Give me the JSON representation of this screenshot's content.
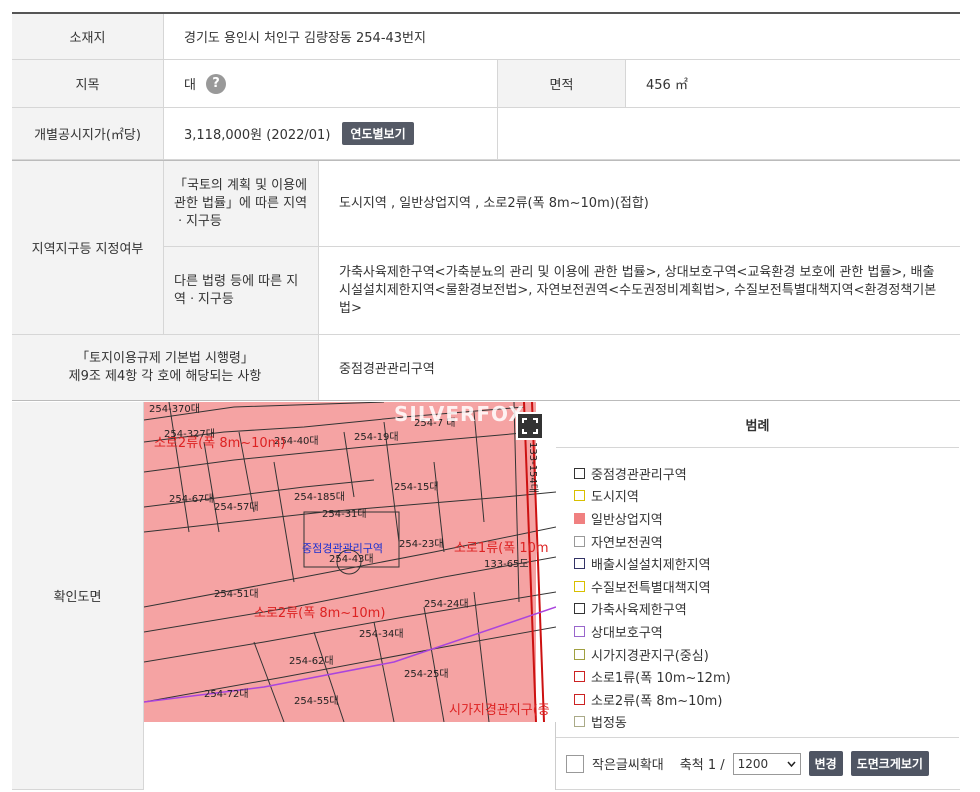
{
  "info": {
    "location_label": "소재지",
    "location_value": "경기도 용인시 처인구 김량장동 254-43번지",
    "category_label": "지목",
    "category_value": "대",
    "help_icon": "?",
    "area_label": "면적",
    "area_value": "456 ㎡",
    "price_label": "개별공시지가(㎡당)",
    "price_value": "3,118,000원 (2022/01)",
    "yearly_button": "연도별보기"
  },
  "zoning": {
    "label": "지역지구등 지정여부",
    "national_label": "「국토의 계획 및 이용에 관한 법률」에 따른 지역ㆍ지구등",
    "national_value": "도시지역 , 일반상업지역 , 소로2류(폭 8m~10m)(접합)",
    "other_label": "다른 법령 등에 따른 지역ㆍ지구등",
    "other_value": "가축사육제한구역<가축분뇨의 관리 및 이용에 관한 법률>, 상대보호구역<교육환경 보호에 관한 법률>, 배출시설설치제한지역<물환경보전법>, 자연보전권역<수도권정비계획법>, 수질보전특별대책지역<환경정책기본법>"
  },
  "rule": {
    "label_line1": "「토지이용규제 기본법 시행령」",
    "label_line2": "제9조 제4항 각 호에 해당되는 사항",
    "value": "중점경관관리구역"
  },
  "map": {
    "label": "확인도면",
    "watermark": "SILVERFOX",
    "parcels": [
      {
        "text": "254-370대"
      },
      {
        "text": "254-327대"
      },
      {
        "text": "254-40대"
      },
      {
        "text": "254-19대"
      },
      {
        "text": "254-7 대"
      },
      {
        "text": "254-185대"
      },
      {
        "text": "254-15대"
      },
      {
        "text": "254-67대"
      },
      {
        "text": "254-57대"
      },
      {
        "text": "254-31대"
      },
      {
        "text": "254-23대"
      },
      {
        "text": "254-43대"
      },
      {
        "text": "133-65도"
      },
      {
        "text": "254-51대"
      },
      {
        "text": "254-24대"
      },
      {
        "text": "254-34대"
      },
      {
        "text": "254-62대"
      },
      {
        "text": "254-25대"
      },
      {
        "text": "254-72대"
      },
      {
        "text": "254-55대"
      },
      {
        "text": "133-154대"
      }
    ],
    "road_labels": [
      {
        "text": "소로2류(폭 8m~10m)"
      },
      {
        "text": "소로2류(폭 8m~10m)"
      },
      {
        "text": "소로1류(폭 10m"
      },
      {
        "text": "시가지경관지구(중"
      }
    ],
    "zone_label": "중점경관관리구역"
  },
  "legend": {
    "title": "범례",
    "items": [
      {
        "label": "중점경관관리구역",
        "color": "#ffffff",
        "border": "#333333"
      },
      {
        "label": "도시지역",
        "color": "#ffffff",
        "border": "#d8c000"
      },
      {
        "label": "일반상업지역",
        "color": "#f08080",
        "border": "#f08080"
      },
      {
        "label": "자연보전권역",
        "color": "#ffffff",
        "border": "#999999"
      },
      {
        "label": "배출시설설치제한지역",
        "color": "#ffffff",
        "border": "#333366"
      },
      {
        "label": "수질보전특별대책지역",
        "color": "#ffffff",
        "border": "#d8c000"
      },
      {
        "label": "가축사육제한구역",
        "color": "#ffffff",
        "border": "#333333"
      },
      {
        "label": "상대보호구역",
        "color": "#ffffff",
        "border": "#9966cc"
      },
      {
        "label": "시가지경관지구(중심)",
        "color": "#ffffff",
        "border": "#a0a040"
      },
      {
        "label": "소로1류(폭 10m~12m)",
        "color": "#ffffff",
        "border": "#cc2222"
      },
      {
        "label": "소로2류(폭 8m~10m)",
        "color": "#ffffff",
        "border": "#cc2222"
      },
      {
        "label": "법정동",
        "color": "#ffffff",
        "border": "#aaaa88"
      }
    ],
    "small_text_label": "작은글씨확대",
    "scale_label": "축척 1 /",
    "scale_value": "1200",
    "change_button": "변경",
    "print_button": "도면크게보기"
  }
}
